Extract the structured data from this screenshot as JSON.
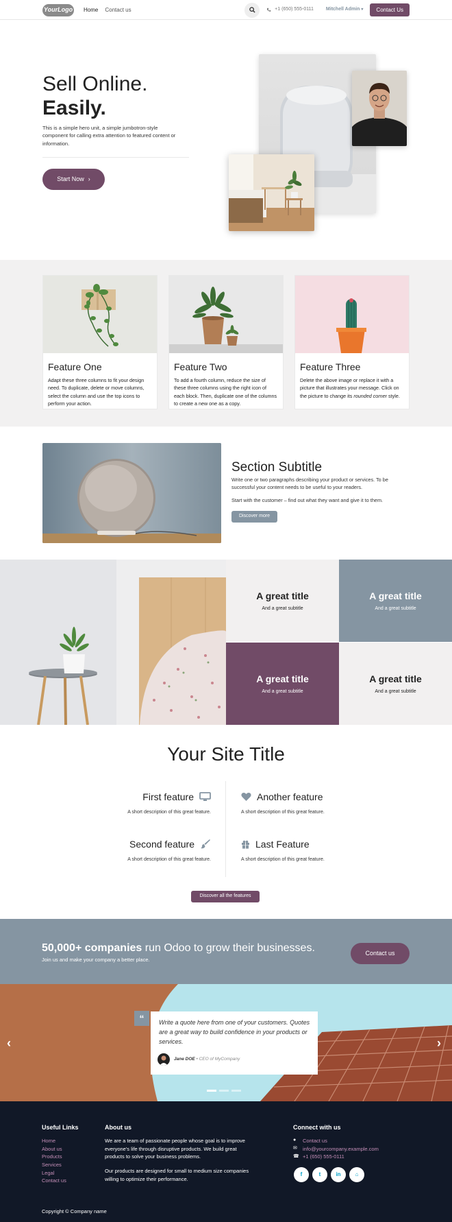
{
  "header": {
    "logo": "YourLogo",
    "nav": [
      "Home",
      "Contact us"
    ],
    "phone": "+1 (650) 555-0111",
    "user": "Mitchell Admin",
    "contact_btn": "Contact Us"
  },
  "hero": {
    "title_line1": "Sell Online.",
    "title_line2": "Easily.",
    "text": "This is a simple hero unit, a simple jumbotron-style component for calling extra attention to featured content or information.",
    "button": "Start Now"
  },
  "cards": [
    {
      "title": "Feature One",
      "text": "Adapt these three columns to fit your design need. To duplicate, delete or move columns, select the column and use the top icons to perform your action."
    },
    {
      "title": "Feature Two",
      "text": "To add a fourth column, reduce the size of these three columns using the right icon of each block. Then, duplicate one of the columns to create a new one as a copy."
    },
    {
      "title": "Feature Three",
      "text_pre": "Delete the above image or replace it with a picture that illustrates your message. Click on the picture to change its ",
      "text_em": "rounded corner",
      "text_post": " style."
    }
  ],
  "subsection": {
    "title": "Section Subtitle",
    "p1": "Write one or two paragraphs describing your product or services. To be successful your content needs to be useful to your readers.",
    "p2": "Start with the customer – find out what they want and give it to them.",
    "button": "Discover more"
  },
  "grid": [
    {
      "title": "A great title",
      "subtitle": "And a great subtitle"
    },
    {
      "title": "A great title",
      "subtitle": "And a great subtitle"
    },
    {
      "title": "A great title",
      "subtitle": "And a great subtitle"
    },
    {
      "title": "A great title",
      "subtitle": "And a great subtitle"
    }
  ],
  "site": {
    "title": "Your Site Title",
    "features": [
      {
        "title": "First feature",
        "text": "A short description of this great feature.",
        "icon": "monitor-icon"
      },
      {
        "title": "Another feature",
        "text": "A short description of this great feature.",
        "icon": "heart-icon"
      },
      {
        "title": "Second feature",
        "text": "A short description of this great feature.",
        "icon": "paint-brush-icon"
      },
      {
        "title": "Last Feature",
        "text": "A short description of this great feature.",
        "icon": "gift-icon"
      }
    ],
    "button": "Discover all the features"
  },
  "cta": {
    "title_bold": "50,000+ companies",
    "title_rest": " run Odoo to grow their businesses.",
    "text": "Join us and make your company a better place.",
    "button": "Contact us"
  },
  "quote": {
    "text": "Write a quote here from one of your customers. Quotes are a great way to build confidence in your products or services.",
    "author": "Jane DOE",
    "role": " • CEO of MyCompany"
  },
  "footer": {
    "links_title": "Useful Links",
    "links": [
      "Home",
      "About us",
      "Products",
      "Services",
      "Legal",
      "Contact us"
    ],
    "about_title": "About us",
    "about_p1": "We are a team of passionate people whose goal is to improve everyone's life through disruptive products. We build great products to solve your business problems.",
    "about_p2": "Our products are designed for small to medium size companies willing to optimize their performance.",
    "connect_title": "Connect with us",
    "connect": [
      "Contact us",
      "info@yourcompany.example.com",
      "+1 (650) 555-0111"
    ],
    "socials": [
      "f",
      "t",
      "in",
      "⌂"
    ],
    "copyright": "Copyright © Company name"
  },
  "colors": {
    "brand": "#714b67",
    "secondary": "#8595a2",
    "footer": "#111827"
  }
}
